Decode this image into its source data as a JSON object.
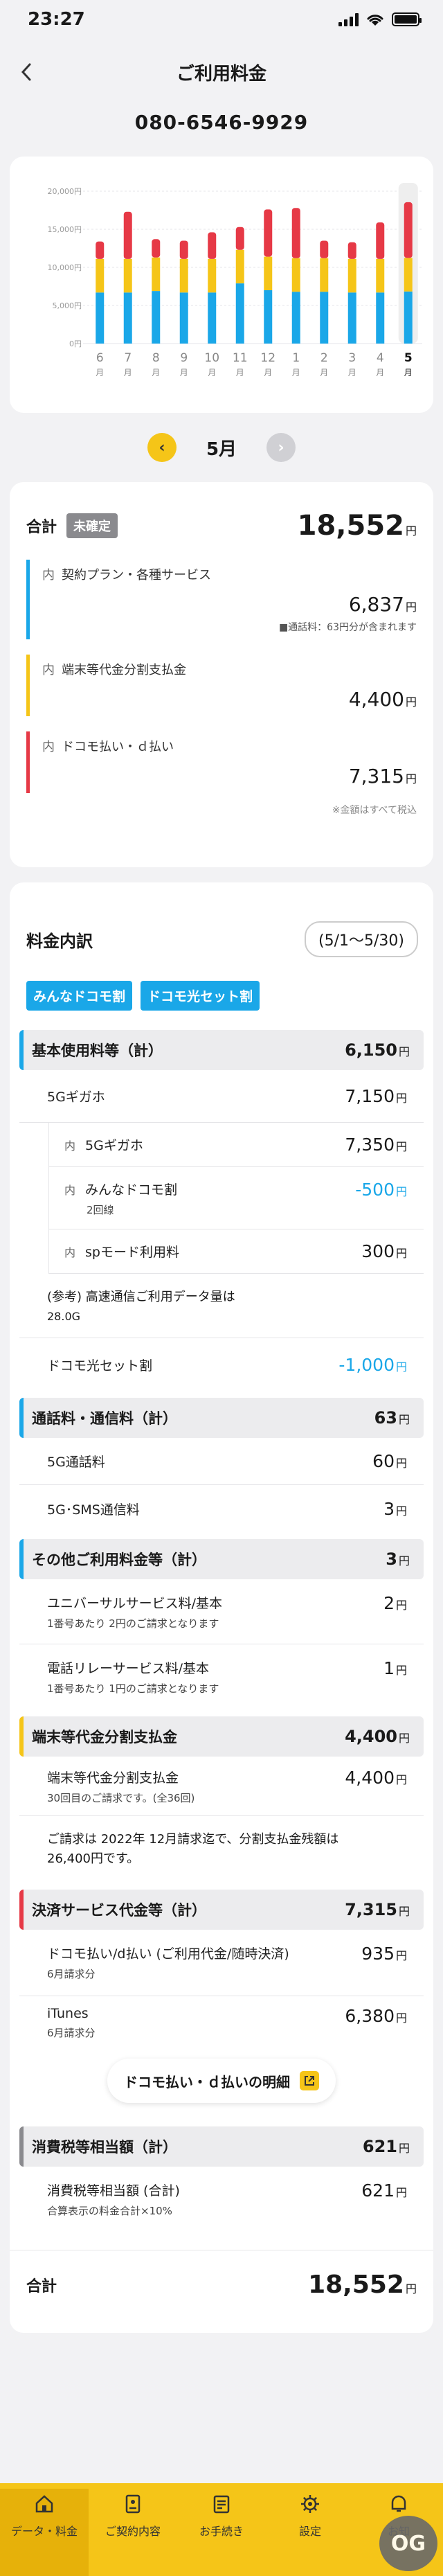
{
  "status": {
    "time": "23:27"
  },
  "nav": {
    "title": "ご利用料金",
    "back_label": "<"
  },
  "phone_number": "080-6546-9929",
  "colors": {
    "accent": "#f5c518",
    "blue": "#1aa7e8",
    "yellow": "#f5c518",
    "red": "#e63946"
  },
  "chart_data": {
    "type": "bar",
    "stacked": true,
    "categories": [
      "6月",
      "7月",
      "8月",
      "9月",
      "10月",
      "11月",
      "12月",
      "1月",
      "2月",
      "3月",
      "4月",
      "5月"
    ],
    "category_top": [
      "6",
      "7",
      "8",
      "9",
      "10",
      "11",
      "12",
      "1",
      "2",
      "3",
      "4",
      "5"
    ],
    "category_bottom": [
      "月",
      "月",
      "月",
      "月",
      "月",
      "月",
      "月",
      "月",
      "月",
      "月",
      "月",
      "月"
    ],
    "series": [
      {
        "name": "契約プラン・各種サービス",
        "color": "#1aa7e8",
        "values": [
          6700,
          6700,
          6900,
          6700,
          6700,
          7900,
          7000,
          6800,
          6800,
          6700,
          6700,
          6837
        ]
      },
      {
        "name": "端末等代金分割支払金",
        "color": "#f5c518",
        "values": [
          4400,
          4400,
          4400,
          4400,
          4400,
          4400,
          4400,
          4400,
          4400,
          4400,
          4400,
          4400
        ]
      },
      {
        "name": "ドコモ払い・d払い",
        "color": "#e63946",
        "values": [
          2300,
          6200,
          2400,
          2400,
          3500,
          3000,
          6200,
          6600,
          2300,
          2200,
          4800,
          7315
        ]
      }
    ],
    "yticks": [
      "20,000円",
      "15,000円",
      "10,000円",
      "5,000円",
      "0円"
    ],
    "ytick_values": [
      20000,
      15000,
      10000,
      5000,
      0
    ],
    "ylim": [
      0,
      20000
    ],
    "selected_index": 11,
    "grid": true
  },
  "month_nav": {
    "label": "5月",
    "prev": "‹",
    "next": "›"
  },
  "summary": {
    "label": "合計",
    "badge": "未確定",
    "total": "18,552",
    "yen": "円",
    "in": "内",
    "items": [
      {
        "label": "契約プラン・各種サービス",
        "amount": "6,837",
        "note": "■通話料：63円分が含まれます"
      },
      {
        "label": "端末等代金分割支払金",
        "amount": "4,400"
      },
      {
        "label": "ドコモ払い・ｄ払い",
        "amount": "7,315"
      }
    ],
    "tax_note": "※金額はすべて税込"
  },
  "detail": {
    "title": "料金内訳",
    "period": "(5/1〜5/30)",
    "tags": [
      "みんなドコモ割",
      "ドコモ光セット割"
    ],
    "sec1": {
      "name": "基本使用料等（計）",
      "value": "6,150",
      "l1": {
        "label": "5Gギガホ",
        "amount": "7,150"
      },
      "l2": {
        "label": "5Gギガホ",
        "amount": "7,350"
      },
      "l3": {
        "label": "みんなドコモ割",
        "sub": "2回線",
        "amount": "-500"
      },
      "l4": {
        "label": "spモード利用料",
        "amount": "300"
      },
      "ref": "(参考) 高速通信ご利用データ量は",
      "ref_val": "28.0G",
      "l5": {
        "label": "ドコモ光セット割",
        "amount": "-1,000"
      }
    },
    "sec2": {
      "name": "通話料・通信料（計）",
      "value": "63",
      "l1": {
        "label": "5G通話料",
        "amount": "60"
      },
      "l2": {
        "label": "5G･SMS通信料",
        "amount": "3"
      }
    },
    "sec3": {
      "name": "その他ご利用料金等（計）",
      "value": "3",
      "l1": {
        "label": "ユニバーサルサービス料/基本",
        "sub": "1番号あたり 2円のご請求となります",
        "amount": "2"
      },
      "l2": {
        "label": "電話リレーサービス料/基本",
        "sub": "1番号あたり 1円のご請求となります",
        "amount": "1"
      }
    },
    "sec4": {
      "name": "端末等代金分割支払金",
      "value": "4,400",
      "l1": {
        "label": "端末等代金分割支払金",
        "sub": "30回目のご請求です。(全36回)",
        "amount": "4,400"
      },
      "para1": "ご請求は 2022年 12月請求迄で、分割支払金残額は",
      "para2": "26,400円です。"
    },
    "sec5": {
      "name": "決済サービス代金等（計）",
      "value": "7,315",
      "l1": {
        "label": "ドコモ払い/d払い (ご利用代金/随時決済)",
        "sub": "6月請求分",
        "amount": "935"
      },
      "l2": {
        "label": "iTunes",
        "sub": "6月請求分",
        "amount": "6,380"
      },
      "button": "ドコモ払い・ｄ払いの明細"
    },
    "sec6": {
      "name": "消費税等相当額（計）",
      "value": "621",
      "l1": {
        "label": "消費税等相当額 (合計)",
        "sub": "合算表示の料金合計×10%",
        "amount": "621"
      }
    },
    "grand_label": "合計",
    "grand_total": "18,552"
  },
  "tabbar": [
    {
      "label": "データ・料金",
      "icon": "home-icon"
    },
    {
      "label": "ご契約内容",
      "icon": "contract-icon"
    },
    {
      "label": "お手続き",
      "icon": "procedure-icon"
    },
    {
      "label": "設定",
      "icon": "gear-icon"
    },
    {
      "label": "お知",
      "icon": "info-icon"
    }
  ],
  "watermark": "OG"
}
